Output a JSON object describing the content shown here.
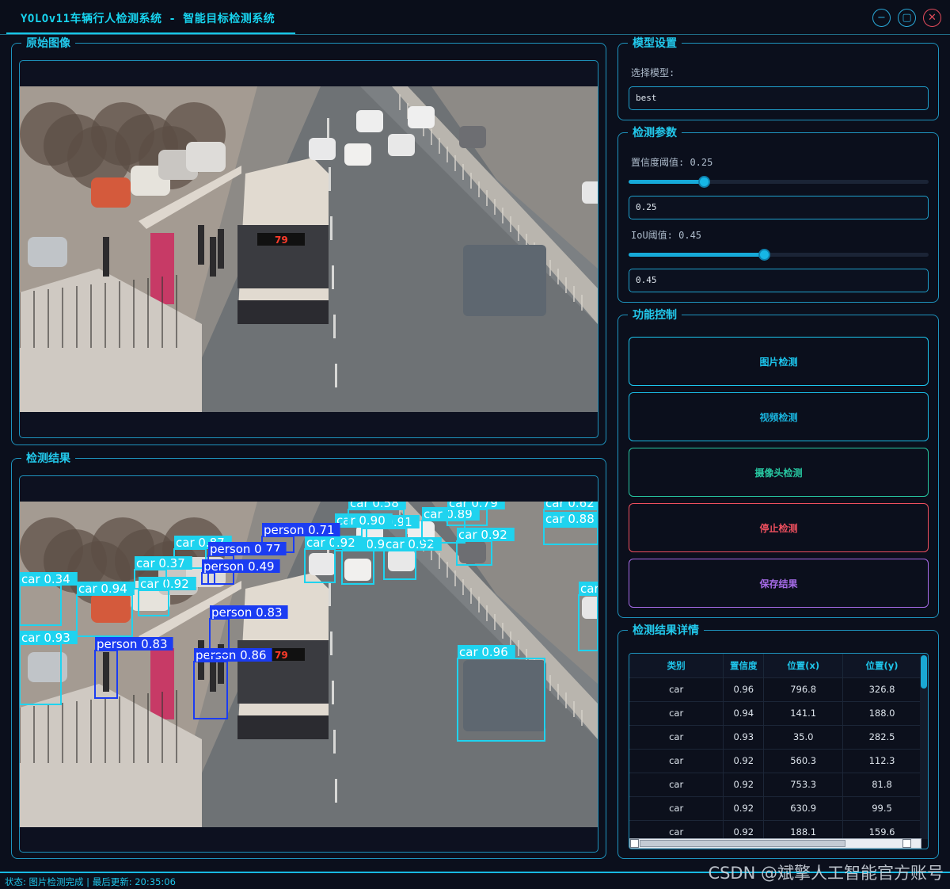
{
  "window": {
    "title": "YOLOv11车辆行人检测系统 - 智能目标检测系统",
    "controls": [
      "minimize-icon",
      "maximize-icon",
      "close-icon"
    ]
  },
  "panels": {
    "original": {
      "title": "原始图像"
    },
    "result": {
      "title": "检测结果"
    }
  },
  "model_settings": {
    "title": "模型设置",
    "select_label": "选择模型:",
    "model_value": "best"
  },
  "params": {
    "title": "检测参数",
    "confidence_label": "置信度阈值: 0.25",
    "confidence_value": "0.25",
    "confidence_level": 0.25,
    "iou_label": "IoU阈值: 0.45",
    "iou_value": "0.45",
    "iou_level": 0.45
  },
  "controls": {
    "title": "功能控制",
    "buttons": [
      {
        "label": "图片检测",
        "color": "#1cc6ee"
      },
      {
        "label": "视频检测",
        "color": "#1ab6e0"
      },
      {
        "label": "摄像头检测",
        "color": "#27c6a0"
      },
      {
        "label": "停止检测",
        "color": "#ee4f5e"
      },
      {
        "label": "保存结果",
        "color": "#a66be8"
      }
    ]
  },
  "details": {
    "title": "检测结果详情",
    "columns": [
      "类别",
      "置信度",
      "位置(x)",
      "位置(y)"
    ],
    "rows": [
      [
        "car",
        "0.96",
        "796.8",
        "326.8"
      ],
      [
        "car",
        "0.94",
        "141.1",
        "188.0"
      ],
      [
        "car",
        "0.93",
        "35.0",
        "282.5"
      ],
      [
        "car",
        "0.92",
        "560.3",
        "112.3"
      ],
      [
        "car",
        "0.92",
        "753.3",
        "81.8"
      ],
      [
        "car",
        "0.92",
        "630.9",
        "99.5"
      ],
      [
        "car",
        "0.92",
        "188.1",
        "159.6"
      ]
    ]
  },
  "detections": [
    {
      "label": "car 0.96",
      "color": "#1fd3ef"
    },
    {
      "label": "car 0.94",
      "color": "#1fd3ef"
    },
    {
      "label": "car 0.93",
      "color": "#1fd3ef"
    },
    {
      "label": "car 0.92",
      "color": "#1fd3ef"
    },
    {
      "label": "car 0.92",
      "color": "#1fd3ef"
    },
    {
      "label": "car 0.92",
      "color": "#1fd3ef"
    },
    {
      "label": "car 0.92",
      "color": "#1fd3ef"
    },
    {
      "label": "car 0.92",
      "color": "#1fd3ef"
    },
    {
      "label": "car 0.91",
      "color": "#1fd3ef"
    },
    {
      "label": "car 0.90",
      "color": "#1fd3ef"
    },
    {
      "label": "car 0.89",
      "color": "#1fd3ef"
    },
    {
      "label": "car 0.88",
      "color": "#1fd3ef"
    },
    {
      "label": "car 0.87",
      "color": "#1fd3ef"
    },
    {
      "label": "car 0.84",
      "color": "#1fd3ef"
    },
    {
      "label": "car 0.79",
      "color": "#1fd3ef"
    },
    {
      "label": "car 0.62",
      "color": "#1fd3ef"
    },
    {
      "label": "car 0.58",
      "color": "#1fd3ef"
    },
    {
      "label": "car 0.37",
      "color": "#1fd3ef"
    },
    {
      "label": "car 0.34",
      "color": "#1fd3ef"
    },
    {
      "label": "person 0.86",
      "color": "#1b3cf2"
    },
    {
      "label": "person 0.83",
      "color": "#1b3cf2"
    },
    {
      "label": "person 0.83",
      "color": "#1b3cf2"
    },
    {
      "label": "person 0.77",
      "color": "#1b3cf2"
    },
    {
      "label": "person 0.71",
      "color": "#1b3cf2"
    },
    {
      "label": "person 0.49",
      "color": "#1b3cf2"
    }
  ],
  "bus_route": "79",
  "status": "状态: 图片检测完成 | 最后更新: 20:35:06",
  "watermark": "CSDN @斌擎人工智能官方账号"
}
